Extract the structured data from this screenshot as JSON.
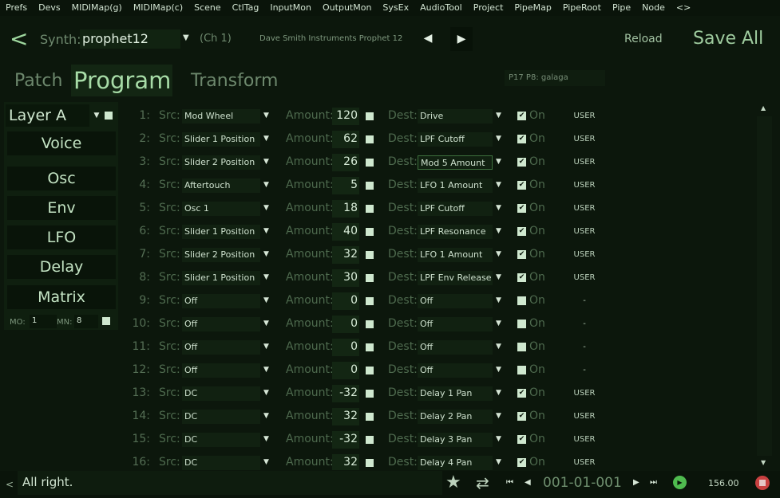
{
  "menu": [
    "Prefs",
    "Devs",
    "MIDIMap(g)",
    "MIDIMap(c)",
    "Scene",
    "CtlTag",
    "InputMon",
    "OutputMon",
    "SysEx",
    "AudioTool",
    "Project",
    "PipeMap",
    "PipeRoot",
    "Pipe",
    "Node",
    "<>"
  ],
  "header": {
    "back": "<",
    "synth_label": "Synth:",
    "synth_value": "prophet12",
    "channel": "(Ch 1)",
    "device": "Dave Smith Instruments Prophet 12",
    "reload": "Reload",
    "save_all": "Save All"
  },
  "tabs": {
    "patch": "Patch",
    "program": "Program",
    "transform": "Transform"
  },
  "program_name": "P17 P8: galaga",
  "sidebar": {
    "layer": "Layer A",
    "buttons": [
      "Voice",
      "Osc",
      "Env",
      "LFO",
      "Delay",
      "Matrix"
    ],
    "mo_label": "MO:",
    "mo_value": "1",
    "mn_label": "MN:",
    "mn_value": "8"
  },
  "matrix": {
    "src_label": "Src:",
    "amount_label": "Amount:",
    "dest_label": "Dest:",
    "on_label": "On",
    "rows": [
      {
        "num": "1:",
        "src": "Mod Wheel",
        "amount": "120",
        "dest": "Drive",
        "flag": "USER"
      },
      {
        "num": "2:",
        "src": "Slider 1 Position",
        "amount": "62",
        "dest": "LPF Cutoff",
        "flag": "USER"
      },
      {
        "num": "3:",
        "src": "Slider 2 Position",
        "amount": "26",
        "dest": "Mod 5 Amount",
        "flag": "USER"
      },
      {
        "num": "4:",
        "src": "Aftertouch",
        "amount": "5",
        "dest": "LFO 1 Amount",
        "flag": "USER"
      },
      {
        "num": "5:",
        "src": "Osc 1",
        "amount": "18",
        "dest": "LPF Cutoff",
        "flag": "USER"
      },
      {
        "num": "6:",
        "src": "Slider 1 Position",
        "amount": "40",
        "dest": "LPF Resonance",
        "flag": "USER"
      },
      {
        "num": "7:",
        "src": "Slider 2 Position",
        "amount": "32",
        "dest": "LFO 1 Amount",
        "flag": "USER"
      },
      {
        "num": "8:",
        "src": "Slider 1 Position",
        "amount": "30",
        "dest": "LPF Env Release",
        "flag": "USER"
      },
      {
        "num": "9:",
        "src": "Off",
        "amount": "0",
        "dest": "Off",
        "flag": "-"
      },
      {
        "num": "10:",
        "src": "Off",
        "amount": "0",
        "dest": "Off",
        "flag": "-"
      },
      {
        "num": "11:",
        "src": "Off",
        "amount": "0",
        "dest": "Off",
        "flag": "-"
      },
      {
        "num": "12:",
        "src": "Off",
        "amount": "0",
        "dest": "Off",
        "flag": "-"
      },
      {
        "num": "13:",
        "src": "DC",
        "amount": "-32",
        "dest": "Delay 1 Pan",
        "flag": "USER"
      },
      {
        "num": "14:",
        "src": "DC",
        "amount": "32",
        "dest": "Delay 2 Pan",
        "flag": "USER"
      },
      {
        "num": "15:",
        "src": "DC",
        "amount": "-32",
        "dest": "Delay 3 Pan",
        "flag": "USER"
      },
      {
        "num": "16:",
        "src": "DC",
        "amount": "32",
        "dest": "Delay 4 Pan",
        "flag": "USER"
      }
    ]
  },
  "status": {
    "arrow": "<",
    "message": "All right.",
    "position": "001-01-001",
    "tempo": "156.00"
  },
  "icons": {
    "favorite": "star-icon",
    "loop": "loop-icon",
    "play": "play-icon",
    "record": "record-icon"
  },
  "colors": {
    "accent": "#a7dca7",
    "background": "#0c170c",
    "play": "#4fbb4f",
    "record": "#c84040"
  }
}
